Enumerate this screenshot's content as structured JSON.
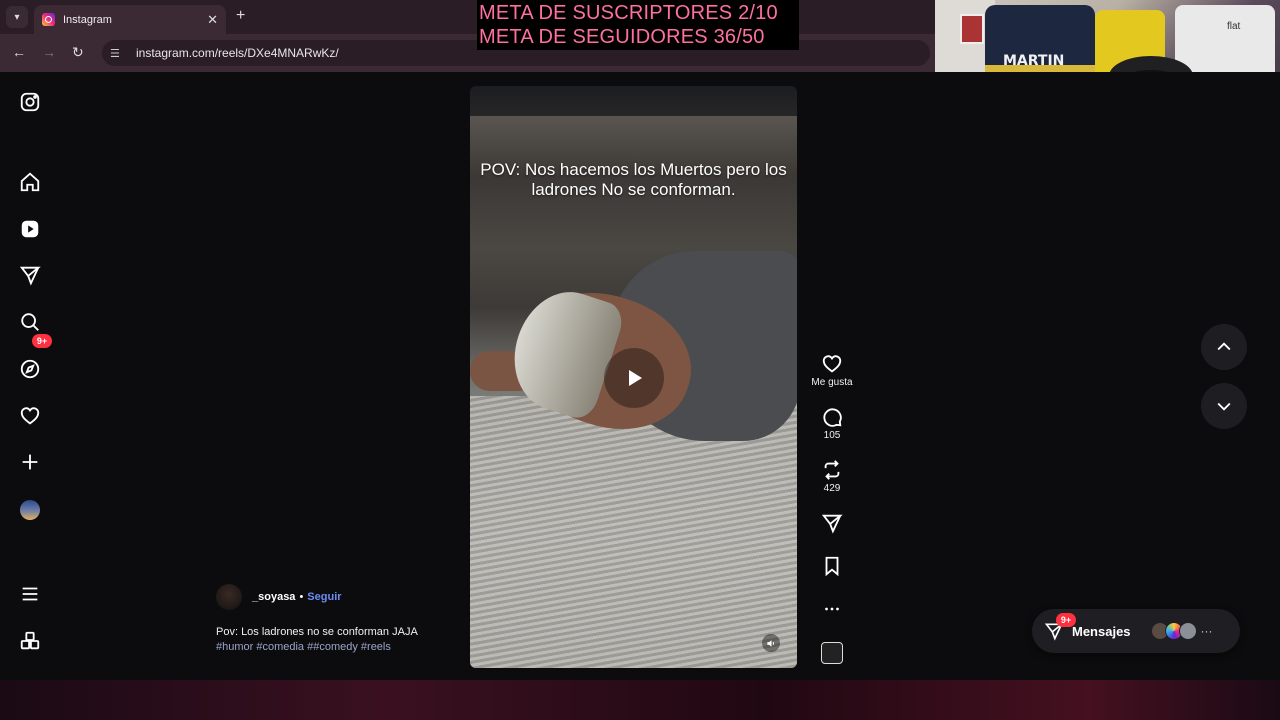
{
  "browser": {
    "tab_title": "Instagram",
    "url": "instagram.com/reels/DXe4MNARwKz/"
  },
  "overlay": {
    "goal_subscribers": "META DE SUSCRIPTORES 2/10",
    "goal_followers": "META DE SEGUIDORES 36/50"
  },
  "webcam": {
    "jersey_name": "MARTIN",
    "jersey_brand": "flat"
  },
  "sidebar": {
    "notifications_badge": "9+"
  },
  "reel": {
    "overlay_caption": "POV: Nos hacemos los Muertos pero los ladrones No se conforman.",
    "author": "_soyasa",
    "separator": "•",
    "follow_label": "Seguir",
    "caption": "Pov: Los ladrones no se conforman JAJA",
    "hashtags": "#humor #comedia ##comedy #reels"
  },
  "actions": {
    "like_label": "Me gusta",
    "comments_count": "105",
    "reposts_count": "429"
  },
  "messages": {
    "label": "Mensajes",
    "badge": "9+",
    "more": "···"
  },
  "colors": {
    "accent_follow": "#6c8cf5",
    "badge": "#ff3040",
    "overlay_text": "#ff6fa1"
  }
}
